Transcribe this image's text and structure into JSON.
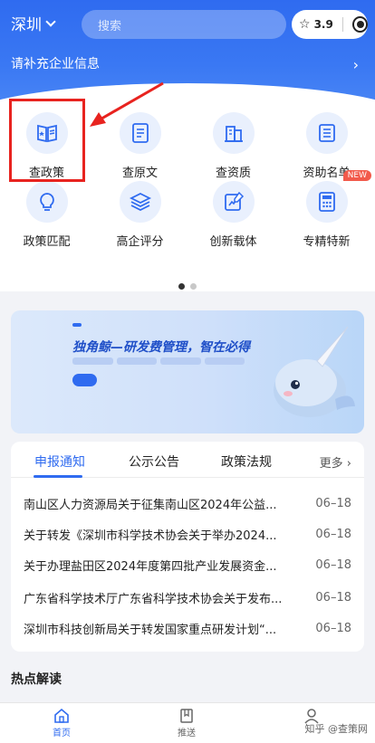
{
  "header": {
    "city": "深圳",
    "search_placeholder": "搜索",
    "rating": "3.9",
    "company_prompt": "请补充企业信息"
  },
  "grid": [
    {
      "label": "查政策",
      "icon": "book-star-icon"
    },
    {
      "label": "查原文",
      "icon": "document-icon"
    },
    {
      "label": "查资质",
      "icon": "building-icon"
    },
    {
      "label": "资助名单",
      "icon": "list-icon"
    },
    {
      "label": "政策匹配",
      "icon": "lightbulb-icon"
    },
    {
      "label": "高企评分",
      "icon": "layers-icon"
    },
    {
      "label": "创新载体",
      "icon": "edit-chart-icon"
    },
    {
      "label": "专精特新",
      "icon": "calculator-icon",
      "badge": "NEW"
    }
  ],
  "banner": {
    "title": "独角鲸—研发费管理，智在必得"
  },
  "notices": {
    "tabs": [
      "申报通知",
      "公示公告",
      "政策法规"
    ],
    "more": "更多",
    "items": [
      {
        "title": "南山区人力资源局关于征集南山区2024年公益...",
        "date": "06–18"
      },
      {
        "title": "关于转发《深圳市科学技术协会关于举办2024...",
        "date": "06–18"
      },
      {
        "title": "关于办理盐田区2024年度第四批产业发展资金...",
        "date": "06–18"
      },
      {
        "title": "广东省科学技术厅广东省科学技术协会关于发布...",
        "date": "06–18"
      },
      {
        "title": "深圳市科技创新局关于转发国家重点研发计划“...",
        "date": "06–18"
      }
    ]
  },
  "hot_title": "热点解读",
  "nav": [
    {
      "label": "首页",
      "active": true
    },
    {
      "label": "推送",
      "active": false
    }
  ],
  "watermark": "知乎 @查策网",
  "colors": {
    "primary": "#2f6bf0",
    "highlight": "#e8231f",
    "badge": "#f25a4b"
  }
}
